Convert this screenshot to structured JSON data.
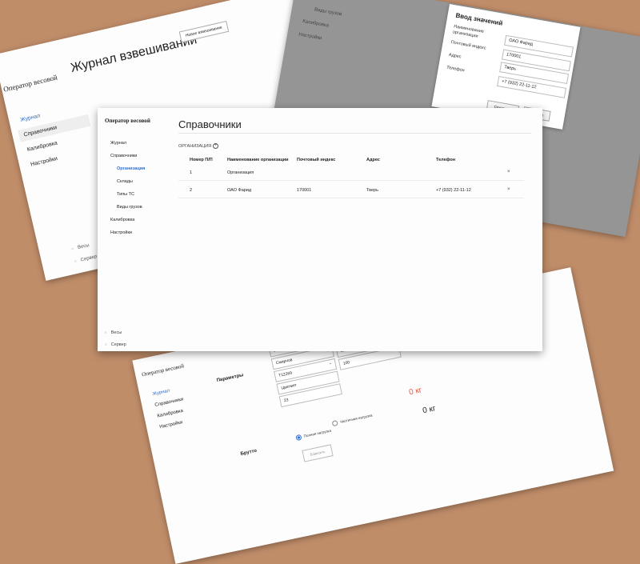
{
  "journal_window": {
    "brand": "Оператор весовой",
    "title": "Журнал взвешиваний",
    "new_button": "Новое взвешивание",
    "nav": [
      "Журнал",
      "Справочники",
      "Калибровка",
      "Настройки"
    ],
    "status": [
      "Весы",
      "Сервер"
    ]
  },
  "gray_window": {
    "items": [
      "Виды грузов",
      "Калибровка",
      "Настройки"
    ],
    "corner_text": "Адрес"
  },
  "dialog": {
    "title": "Ввод значений",
    "fields": [
      {
        "label": "Наименование организации",
        "value": "ОАО Фарид"
      },
      {
        "label": "Почтовый индекс",
        "value": "170001"
      },
      {
        "label": "Адрес",
        "value": "Тверь"
      },
      {
        "label": "Телефон",
        "value": "+7 (932) 22-11-12"
      }
    ],
    "save": "Сохранить",
    "cancel": "Отмена"
  },
  "weigh_window": {
    "brand": "Оператор весовой",
    "nav": [
      "Журнал",
      "Справочники",
      "Калибровка",
      "Настройки"
    ],
    "params_label": "Параметры",
    "inputs": [
      "Весы",
      "Смирнов",
      "Т12269",
      "Цветмет",
      "23"
    ],
    "extra_inputs": [
      "Зил-130",
      "100"
    ],
    "rub": "руб.",
    "brutto_label": "Брутто",
    "radio_full": "Полная нагрузка",
    "radio_partial": "Частичная нагрузка",
    "weight_red": "0 кг",
    "weight_black": "0 кг",
    "calc_button": "Взвесить"
  },
  "main_window": {
    "brand": "Оператор весовой",
    "title": "Справочники",
    "nav": {
      "journal": "Журнал",
      "references": "Справочники",
      "organization": "Организация",
      "warehouses": "Склады",
      "vehicle_types": "Типы ТС",
      "cargo_types": "Виды грузов",
      "calibration": "Калибровка",
      "settings": "Настройки"
    },
    "status": {
      "scales": "Весы",
      "server": "Сервер"
    },
    "section_label": "ОРГАНИЗАЦИЯ",
    "table": {
      "headers": [
        "Номер П/П",
        "Наименование организации",
        "Почтовый индекс",
        "Адрес",
        "Телефон"
      ],
      "rows": [
        [
          "1",
          "Организация",
          "",
          "",
          ""
        ],
        [
          "2",
          "ОАО Фарид",
          "170001",
          "Тверь",
          "+7 (932) 22-11-12"
        ]
      ]
    }
  }
}
